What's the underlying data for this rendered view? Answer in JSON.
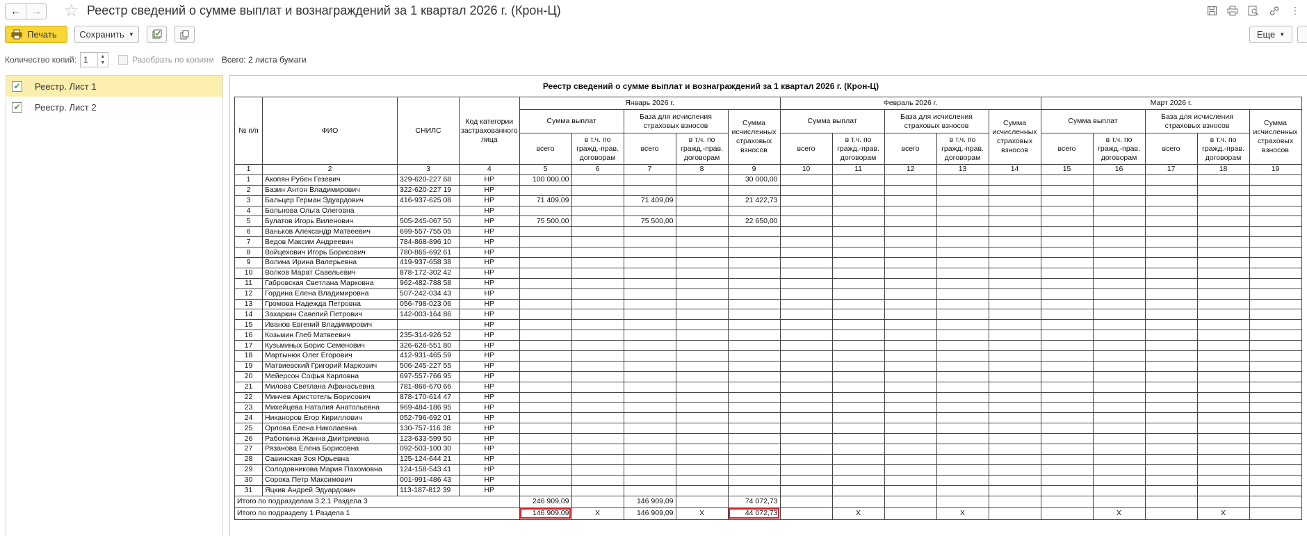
{
  "window": {
    "title": "Реестр сведений о сумме выплат и вознаграждений за 1 квартал 2026 г. (Крон-Ц)",
    "nav_back": "←",
    "nav_forward": "→",
    "favorite_icon": "star-icon",
    "icons": [
      "save-icon",
      "print-icon",
      "preview-icon",
      "link-icon",
      "more-icon"
    ]
  },
  "toolbar": {
    "print_label": "Печать",
    "save_label": "Сохранить",
    "more_label": "Еще"
  },
  "copies": {
    "label": "Количество копий:",
    "value": "1",
    "collate_label": "Разобрать по копиям",
    "total": "Всего: 2 листа бумаги"
  },
  "sheets": [
    {
      "label": "Реестр. Лист 1",
      "checked": true,
      "selected": true
    },
    {
      "label": "Реестр. Лист 2",
      "checked": true,
      "selected": false
    }
  ],
  "report": {
    "title": "Реестр сведений о сумме выплат и вознаграждений за 1 квартал 2026 г. (Крон-Ц)",
    "headers": {
      "num": "№ п/п",
      "fio": "ФИО",
      "snils": "СНИЛС",
      "code": "Код категории застрахованного лица",
      "months": [
        "Январь 2026 г.",
        "Февраль 2026 г.",
        "Март 2026 г."
      ],
      "payments": "Сумма выплат",
      "base": "База для исчисления страховых взносов",
      "contrib": "Сумма исчисленных страховых взносов",
      "total": "всего",
      "incl": "в т.ч. по гражд.-прав. договорам"
    },
    "col_numbers": [
      "1",
      "2",
      "3",
      "4",
      "5",
      "6",
      "7",
      "8",
      "9",
      "10",
      "11",
      "12",
      "13",
      "14",
      "15",
      "16",
      "17",
      "18",
      "19"
    ],
    "rows": [
      {
        "n": "1",
        "fio": "Акопян Рубен Гезевич",
        "snils": "329-620-227 68",
        "code": "НР",
        "p": "100 000,00",
        "pc": "",
        "b": "",
        "bc": "",
        "s": "30 000,00"
      },
      {
        "n": "2",
        "fio": "Базин Антон Владимирович",
        "snils": "322-620-227 19",
        "code": "НР",
        "p": "",
        "pc": "",
        "b": "",
        "bc": "",
        "s": ""
      },
      {
        "n": "3",
        "fio": "Бальцер Герман Эдуардович",
        "snils": "416-937-625 08",
        "code": "НР",
        "p": "71 409,09",
        "pc": "",
        "b": "71 409,09",
        "bc": "",
        "s": "21 422,73"
      },
      {
        "n": "4",
        "fio": "Больнова Ольга Олеговна",
        "snils": "",
        "code": "НР",
        "p": "",
        "pc": "",
        "b": "",
        "bc": "",
        "s": ""
      },
      {
        "n": "5",
        "fio": "Булатов Игорь Виленович",
        "snils": "505-245-067 50",
        "code": "НР",
        "p": "75 500,00",
        "pc": "",
        "b": "75 500,00",
        "bc": "",
        "s": "22 650,00"
      },
      {
        "n": "6",
        "fio": "Ваньков Александр Матвеевич",
        "snils": "699-557-755 05",
        "code": "НР",
        "p": "",
        "pc": "",
        "b": "",
        "bc": "",
        "s": ""
      },
      {
        "n": "7",
        "fio": "Ведов Максим Андреевич",
        "snils": "784-868-896 10",
        "code": "НР",
        "p": "",
        "pc": "",
        "b": "",
        "bc": "",
        "s": ""
      },
      {
        "n": "8",
        "fio": "Войцехович Игорь Борисович",
        "snils": "780-865-692 61",
        "code": "НР",
        "p": "",
        "pc": "",
        "b": "",
        "bc": "",
        "s": ""
      },
      {
        "n": "9",
        "fio": "Волина Ирина Валерьевна",
        "snils": "419-937-658 38",
        "code": "НР",
        "p": "",
        "pc": "",
        "b": "",
        "bc": "",
        "s": ""
      },
      {
        "n": "10",
        "fio": "Волков Марат Савельевич",
        "snils": "878-172-302 42",
        "code": "НР",
        "p": "",
        "pc": "",
        "b": "",
        "bc": "",
        "s": ""
      },
      {
        "n": "11",
        "fio": "Габровская Светлана Марковна",
        "snils": "962-482-788 58",
        "code": "НР",
        "p": "",
        "pc": "",
        "b": "",
        "bc": "",
        "s": ""
      },
      {
        "n": "12",
        "fio": "Гордина Елена Владимировна",
        "snils": "507-242-034 43",
        "code": "НР",
        "p": "",
        "pc": "",
        "b": "",
        "bc": "",
        "s": ""
      },
      {
        "n": "13",
        "fio": "Громова Надежда Петровна",
        "snils": "056-798-023 06",
        "code": "НР",
        "p": "",
        "pc": "",
        "b": "",
        "bc": "",
        "s": ""
      },
      {
        "n": "14",
        "fio": "Захаркин Савелий Петрович",
        "snils": "142-003-164 86",
        "code": "НР",
        "p": "",
        "pc": "",
        "b": "",
        "bc": "",
        "s": ""
      },
      {
        "n": "15",
        "fio": "Иванов Евгений Владимирович",
        "snils": "",
        "code": "НР",
        "p": "",
        "pc": "",
        "b": "",
        "bc": "",
        "s": ""
      },
      {
        "n": "16",
        "fio": "Козьмин Глеб Матвеевич",
        "snils": "235-314-926 52",
        "code": "НР",
        "p": "",
        "pc": "",
        "b": "",
        "bc": "",
        "s": ""
      },
      {
        "n": "17",
        "fio": "Кузьминых Борис Семенович",
        "snils": "326-626-551 80",
        "code": "НР",
        "p": "",
        "pc": "",
        "b": "",
        "bc": "",
        "s": ""
      },
      {
        "n": "18",
        "fio": "Мартынюк Олег Егорович",
        "snils": "412-931-465 59",
        "code": "НР",
        "p": "",
        "pc": "",
        "b": "",
        "bc": "",
        "s": ""
      },
      {
        "n": "19",
        "fio": "Матвиевский Григорий Маркович",
        "snils": "506-245-227 55",
        "code": "НР",
        "p": "",
        "pc": "",
        "b": "",
        "bc": "",
        "s": ""
      },
      {
        "n": "20",
        "fio": "Мейерсон Софья Карловна",
        "snils": "697-557-766 95",
        "code": "НР",
        "p": "",
        "pc": "",
        "b": "",
        "bc": "",
        "s": ""
      },
      {
        "n": "21",
        "fio": "Милова Светлана Афанасьевна",
        "snils": "781-866-670 66",
        "code": "НР",
        "p": "",
        "pc": "",
        "b": "",
        "bc": "",
        "s": ""
      },
      {
        "n": "22",
        "fio": "Минчев Аристотель Борисович",
        "snils": "878-170-614 47",
        "code": "НР",
        "p": "",
        "pc": "",
        "b": "",
        "bc": "",
        "s": ""
      },
      {
        "n": "23",
        "fio": "Михейцева Наталия Анатольевна",
        "snils": "969-484-186 95",
        "code": "НР",
        "p": "",
        "pc": "",
        "b": "",
        "bc": "",
        "s": ""
      },
      {
        "n": "24",
        "fio": "Никаноров Егор Кириллович",
        "snils": "052-796-692 01",
        "code": "НР",
        "p": "",
        "pc": "",
        "b": "",
        "bc": "",
        "s": ""
      },
      {
        "n": "25",
        "fio": "Орлова Елена Николаевна",
        "snils": "130-757-116 38",
        "code": "НР",
        "p": "",
        "pc": "",
        "b": "",
        "bc": "",
        "s": ""
      },
      {
        "n": "26",
        "fio": "Работкина Жанна Дмитриевна",
        "snils": "123-633-599 50",
        "code": "НР",
        "p": "",
        "pc": "",
        "b": "",
        "bc": "",
        "s": ""
      },
      {
        "n": "27",
        "fio": "Рязанова Елена Борисовна",
        "snils": "092-503-100 30",
        "code": "НР",
        "p": "",
        "pc": "",
        "b": "",
        "bc": "",
        "s": ""
      },
      {
        "n": "28",
        "fio": "Савинская Зоя Юрьевна",
        "snils": "125-124-644 21",
        "code": "НР",
        "p": "",
        "pc": "",
        "b": "",
        "bc": "",
        "s": ""
      },
      {
        "n": "29",
        "fio": "Солодовникова Мария Пахомовна",
        "snils": "124-158-543 41",
        "code": "НР",
        "p": "",
        "pc": "",
        "b": "",
        "bc": "",
        "s": ""
      },
      {
        "n": "30",
        "fio": "Сорока Петр Максимович",
        "snils": "001-991-486 43",
        "code": "НР",
        "p": "",
        "pc": "",
        "b": "",
        "bc": "",
        "s": ""
      },
      {
        "n": "31",
        "fio": "Яцкив Андрей Эдуардович",
        "snils": "113-187-812 39",
        "code": "НР",
        "p": "",
        "pc": "",
        "b": "",
        "bc": "",
        "s": ""
      }
    ],
    "totals": [
      {
        "label": "Итого по подразделам 3.2.1 Раздела 3",
        "jan": [
          "246 909,09",
          "",
          "146 909,09",
          "",
          "74 072,73"
        ],
        "feb": [
          "",
          "",
          "",
          "",
          ""
        ],
        "mar": [
          "",
          "",
          "",
          "",
          ""
        ],
        "highlight": false
      },
      {
        "label": "Итого по подразделу 1 Раздела 1",
        "jan": [
          "146 909,09",
          "X",
          "146 909,09",
          "X",
          "44 072,73"
        ],
        "feb": [
          "",
          "X",
          "",
          "X",
          ""
        ],
        "mar": [
          "",
          "X",
          "",
          "X",
          ""
        ],
        "highlight": true
      }
    ],
    "highlight_color": "#d9232d"
  }
}
